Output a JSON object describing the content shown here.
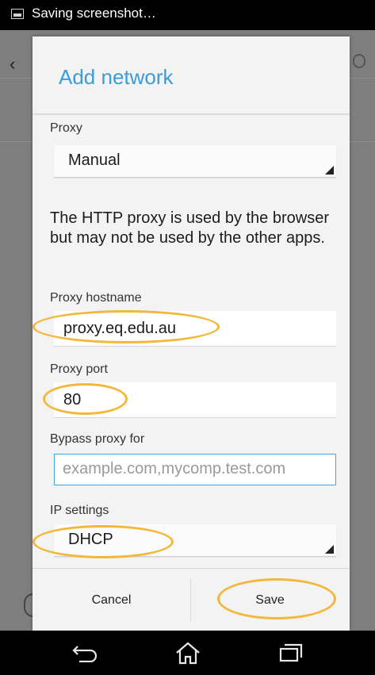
{
  "status_bar": {
    "text": "Saving screenshot…"
  },
  "dialog": {
    "title": "Add network",
    "proxy": {
      "label": "Proxy",
      "value": "Manual"
    },
    "note": "The HTTP proxy is used by the browser but may not be used by the other apps.",
    "proxy_hostname": {
      "label": "Proxy hostname",
      "value": "proxy.eq.edu.au"
    },
    "proxy_port": {
      "label": "Proxy port",
      "value": "80"
    },
    "bypass": {
      "label": "Bypass proxy for",
      "placeholder": "example.com,mycomp.test.com"
    },
    "ip_settings": {
      "label": "IP settings",
      "value": "DHCP"
    },
    "buttons": {
      "cancel": "Cancel",
      "save": "Save"
    }
  },
  "colors": {
    "accent": "#3a9dd6",
    "highlight": "#f3b83a"
  },
  "icons": [
    "image-icon",
    "back-icon",
    "home-icon",
    "recents-icon",
    "dropdown-triangle-icon"
  ]
}
